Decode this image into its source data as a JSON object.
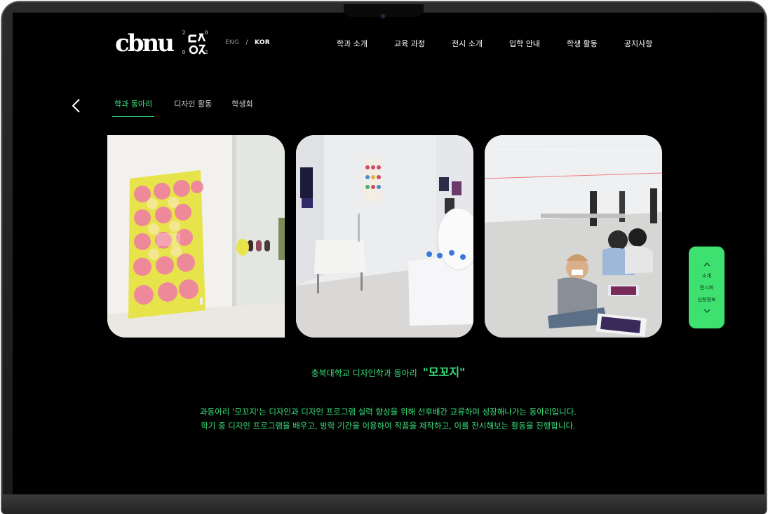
{
  "logo": {
    "text": "cbnu",
    "mark_hangul": "ㄷㅎㅈ",
    "digits": [
      "2",
      "0",
      "0",
      "2"
    ]
  },
  "language": {
    "eng": "ENG",
    "separator": "/",
    "kor": "KOR",
    "selected": "KOR"
  },
  "nav": {
    "items": [
      {
        "label": "학과 소개"
      },
      {
        "label": "교육 과정"
      },
      {
        "label": "전시 소개"
      },
      {
        "label": "입학 안내"
      },
      {
        "label": "학생 활동"
      },
      {
        "label": "공지사항"
      }
    ]
  },
  "subnav": {
    "back_icon": "chevron-left-icon",
    "tabs": [
      {
        "label": "학과 동아리",
        "active": true
      },
      {
        "label": "디자인 활동",
        "active": false
      },
      {
        "label": "학생회",
        "active": false
      }
    ]
  },
  "side_widget": {
    "up_icon": "chevron-up-icon",
    "down_icon": "chevron-down-icon",
    "items": [
      "소개",
      "전시회",
      "신청정보"
    ]
  },
  "club": {
    "prefix": "충북대학교 디자인학과 동아리",
    "name": "\"모꼬지\""
  },
  "description": {
    "line1": "과동아리 '모꼬지'는 디자인과 디자인 프로그램 실력 향상을 위해 선후배간 교류하며 성장해나가는 동아리입니다.",
    "line2": "학기 중 디자인 프로그램을 배우고, 방학 기간을 이용하여 작품을 제작하고, 이를 전시해보는 활동을 진행합니다."
  },
  "colors": {
    "accent": "#39e07a",
    "widget_bg": "#3ee06f",
    "background": "#000000"
  }
}
